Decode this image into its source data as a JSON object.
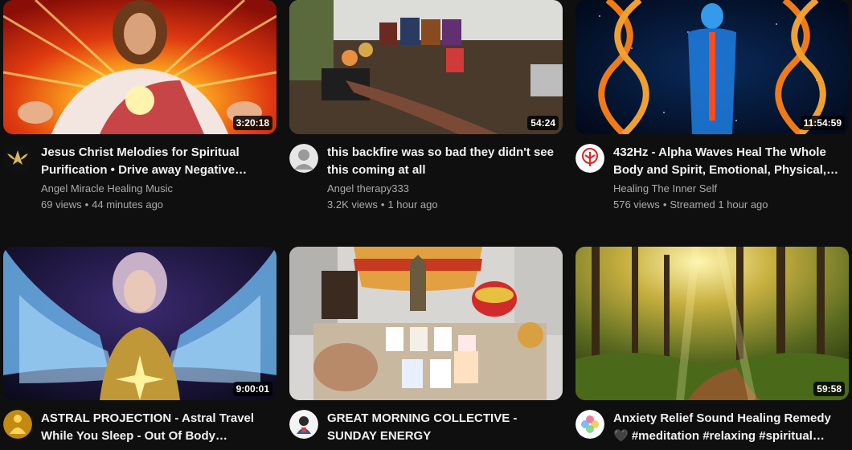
{
  "videos": [
    {
      "title": "Jesus Christ Melodies for Spiritual Purification • Drive away Negative Energy",
      "duration": "3:20:18",
      "channel": "Angel Miracle Healing Music",
      "views": "69 views",
      "age": "44 minutes ago",
      "thumb_icon": "jesus-radiant-thumbnail",
      "avatar_icon": "angel-logo-icon"
    },
    {
      "title": "this backfire was so bad they didn't see this coming at all",
      "duration": "54:24",
      "channel": "Angel therapy333",
      "views": "3.2K views",
      "age": "1 hour ago",
      "thumb_icon": "tarot-cards-table-thumbnail",
      "avatar_icon": "angel-therapy-avatar-icon"
    },
    {
      "title": "432Hz - Alpha Waves Heal The Whole Body and Spirit, Emotional, Physical, Mental",
      "duration": "11:54:59",
      "channel": "Healing The Inner Self",
      "views": "576 views",
      "age": "Streamed 1 hour ago",
      "thumb_icon": "dna-body-thumbnail",
      "avatar_icon": "red-tree-logo-icon"
    },
    {
      "title": "ASTRAL PROJECTION - Astral Travel While You Sleep - Out Of Body Experience",
      "duration": "9:00:01",
      "channel": "",
      "views": "",
      "age": "",
      "thumb_icon": "winged-angel-thumbnail",
      "avatar_icon": "golden-meditation-icon"
    },
    {
      "title": "GREAT MORNING COLLECTIVE - SUNDAY ENERGY",
      "duration": "",
      "channel": "",
      "views": "",
      "age": "",
      "thumb_icon": "altar-tarot-thumbnail",
      "avatar_icon": "character-avatar-icon"
    },
    {
      "title": "Anxiety Relief Sound Healing Remedy 🖤 #meditation #relaxing #spiritual #healing",
      "duration": "59:58",
      "channel": "",
      "views": "",
      "age": "",
      "thumb_icon": "sunlit-forest-thumbnail",
      "avatar_icon": "colorful-mandala-icon"
    }
  ],
  "colors": {
    "background": "#0f0f0f",
    "title": "#f1f1f1",
    "secondary": "#aaaaaa"
  }
}
